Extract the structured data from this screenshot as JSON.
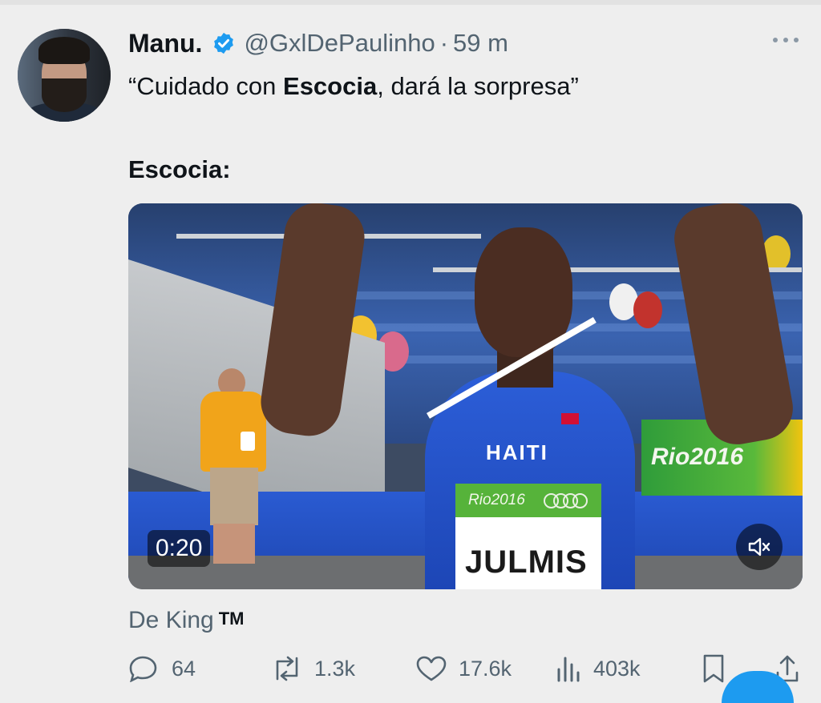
{
  "author": {
    "display_name": "Manu.",
    "handle": "@GxlDePaulinho",
    "separator": "·",
    "time": "59 m",
    "verified": true
  },
  "tweet": {
    "line1_prefix": "“Cuidado con ",
    "line1_bold": "Escocia",
    "line1_suffix": ", dará la sorpresa”",
    "line2": "Escocia:"
  },
  "media": {
    "duration": "0:20",
    "bib_name": "JULMIS",
    "singlet_text": "HAITI",
    "bib_event": "Rio2016",
    "board_text": "Rio2016",
    "muted": true
  },
  "source": {
    "label": "De King",
    "mark": "TM"
  },
  "actions": {
    "replies": "64",
    "reposts": "1.3k",
    "likes": "17.6k",
    "views": "403k"
  },
  "icons": {
    "verified": "verified-badge-icon",
    "more": "more-icon",
    "mute": "mute-icon",
    "reply": "reply-icon",
    "repost": "repost-icon",
    "like": "like-icon",
    "views": "views-icon",
    "bookmark": "bookmark-icon",
    "share": "share-icon"
  },
  "colors": {
    "accent": "#1d9bf0",
    "text": "#0f1419",
    "secondary": "#536471",
    "background": "#eeeeee"
  }
}
